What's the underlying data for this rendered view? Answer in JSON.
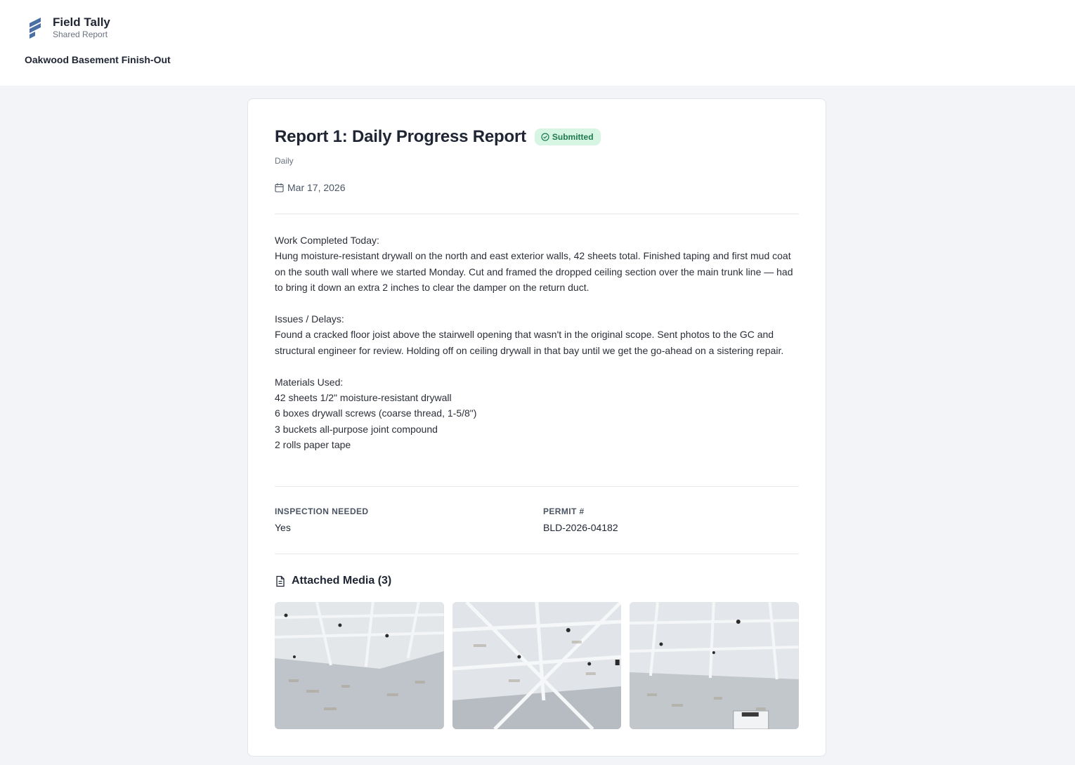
{
  "app": {
    "name": "Field Tally",
    "subtitle": "Shared Report",
    "logo_icon": "field-tally-logo",
    "brand_color": "#4a6fa5"
  },
  "project": {
    "title": "Oakwood Basement Finish-Out"
  },
  "report": {
    "title": "Report 1: Daily Progress Report",
    "status": "Submitted",
    "status_icon": "check-circle-icon",
    "status_color": "#1f7a4d",
    "type": "Daily",
    "date": "Mar 17, 2026",
    "date_icon": "calendar-icon",
    "body": [
      "Work Completed Today:\nHung moisture-resistant drywall on the north and east exterior walls, 42 sheets total. Finished taping and first mud coat on the south wall where we started Monday. Cut and framed the dropped ceiling section over the main trunk line — had to bring it down an extra 2 inches to clear the damper on the return duct.",
      "Issues / Delays:\nFound a cracked floor joist above the stairwell opening that wasn't in the original scope. Sent photos to the GC and structural engineer for review. Holding off on ceiling drywall in that bay until we get the go-ahead on a sistering repair.",
      "Materials Used:\n42 sheets 1/2\" moisture-resistant drywall\n6 boxes drywall screws (coarse thread, 1-5/8\")\n3 buckets all-purpose joint compound\n2 rolls paper tape"
    ],
    "fields": [
      {
        "label": "INSPECTION NEEDED",
        "value": "Yes"
      },
      {
        "label": "PERMIT #",
        "value": "BLD-2026-04182"
      }
    ],
    "media": {
      "heading": "Attached Media (3)",
      "icon": "document-icon",
      "items": [
        {
          "type": "photo",
          "subject": "drywall coffered ceiling"
        },
        {
          "type": "photo",
          "subject": "drywall coffered ceiling"
        },
        {
          "type": "photo",
          "subject": "drywall coffered ceiling"
        }
      ]
    }
  }
}
